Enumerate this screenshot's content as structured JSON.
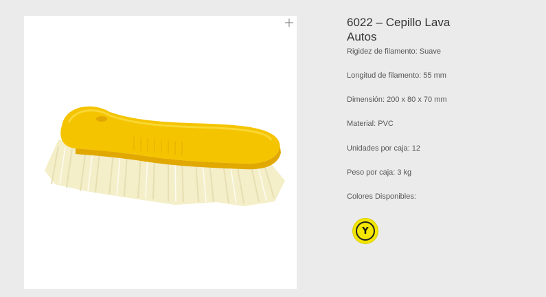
{
  "product": {
    "title": "6022 – Cepillo Lava Autos",
    "attributes": [
      "Rigidez de filamento: Suave",
      "Longitud de filamento: 55 mm",
      "Dimensión: 200 x 80 x 70 mm",
      "Material: PVC",
      "Unidades por caja: 12",
      "Peso por caja: 3 kg",
      "Colores Disponibles:"
    ],
    "color_swatches": [
      {
        "label": "Y",
        "color": "#f3e600"
      }
    ]
  },
  "icons": {
    "zoom": "plus-icon"
  },
  "colors": {
    "brush_body": "#f5c400",
    "bristles": "#f3edc4",
    "background": "#ebebeb"
  }
}
